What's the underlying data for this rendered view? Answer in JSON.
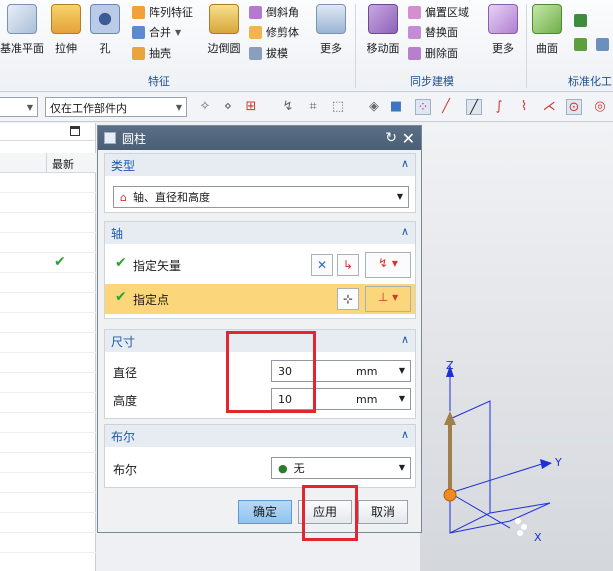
{
  "ribbon": {
    "buttons_big": [
      {
        "label": "基准平面"
      },
      {
        "label": "拉伸"
      },
      {
        "label": "孔"
      },
      {
        "label": "边倒圆"
      },
      {
        "label": "更多"
      },
      {
        "label": "移动面"
      },
      {
        "label": "更多"
      },
      {
        "label": "曲面"
      }
    ],
    "feature_small": [
      "阵列特征",
      "合并",
      "抽壳"
    ],
    "edge_small": [
      "倒斜角",
      "修剪体",
      "拔模"
    ],
    "sync_small": [
      "偏置区域",
      "替换面",
      "删除面"
    ],
    "groups": {
      "feature": "特征",
      "sync": "同步建模",
      "std": "标准化工"
    }
  },
  "toolbar2": {
    "select_value": "仅在工作部件内"
  },
  "left_panel": {
    "col_header": "最新",
    "checked_row": "✔"
  },
  "dialog": {
    "title": "圆柱",
    "type_section": {
      "title": "类型",
      "value": "轴、直径和高度"
    },
    "axis_section": {
      "title": "轴",
      "vector_label": "指定矢量",
      "point_label": "指定点"
    },
    "size_section": {
      "title": "尺寸",
      "diameter_label": "直径",
      "diameter_value": "30",
      "height_label": "高度",
      "height_value": "10",
      "unit": "mm"
    },
    "bool_section": {
      "title": "布尔",
      "label": "布尔",
      "value": "无"
    },
    "buttons": {
      "ok": "确定",
      "apply": "应用",
      "cancel": "取消"
    }
  },
  "viewport": {
    "axis_x": "X",
    "axis_y": "Y",
    "axis_z": "Z"
  },
  "colors": {
    "highlight": "#e3262d",
    "selected_row": "#fbd67a",
    "accent": "#1e5aa8"
  }
}
